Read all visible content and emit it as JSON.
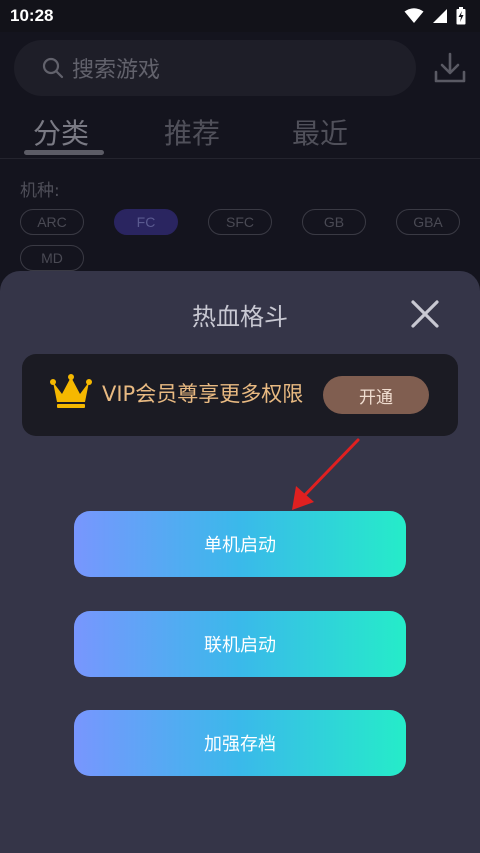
{
  "status_bar": {
    "time": "10:28"
  },
  "search": {
    "placeholder": "搜索游戏"
  },
  "tabs": [
    {
      "label": "分类",
      "active": true
    },
    {
      "label": "推荐",
      "active": false
    },
    {
      "label": "最近",
      "active": false
    }
  ],
  "filter": {
    "label": "机种:",
    "chips": [
      {
        "label": "ARC",
        "selected": false
      },
      {
        "label": "FC",
        "selected": true
      },
      {
        "label": "SFC",
        "selected": false
      },
      {
        "label": "GB",
        "selected": false
      },
      {
        "label": "GBA",
        "selected": false
      },
      {
        "label": "MD",
        "selected": false
      }
    ]
  },
  "sheet": {
    "title": "热血格斗",
    "vip_text": "VIP会员尊享更多权限",
    "vip_button": "开通",
    "buttons": [
      {
        "label": "单机启动"
      },
      {
        "label": "联机启动"
      },
      {
        "label": "加强存档"
      }
    ]
  },
  "colors": {
    "accent_gold": "#e9ba82",
    "vip_button_bg": "#805e50",
    "gradient_start": "#7896fe",
    "gradient_end": "#25ecc9",
    "arrow_red": "#e02020"
  }
}
